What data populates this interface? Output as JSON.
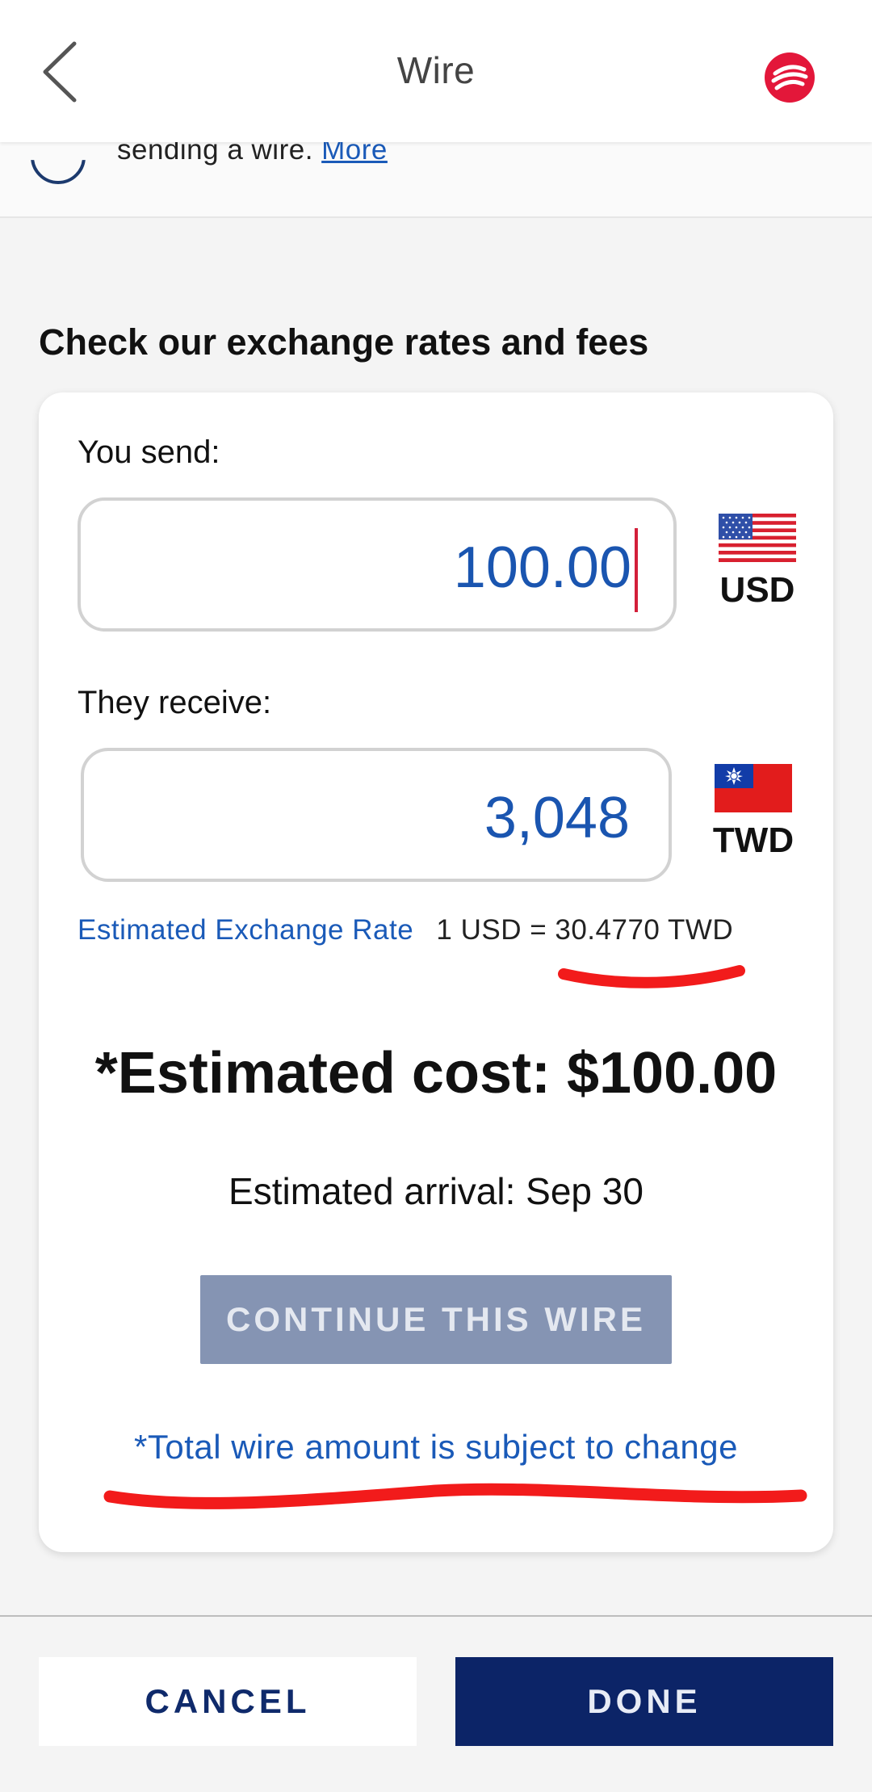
{
  "header": {
    "title": "Wire",
    "back_icon": "chevron-left-icon",
    "logo_icon": "bank-logo-icon",
    "brand_color": "#e3173a"
  },
  "info": {
    "text": "sending a wire.",
    "link_label": "More",
    "icon": "info-icon"
  },
  "section": {
    "title": "Check our exchange rates and fees"
  },
  "converter": {
    "send_label": "You send:",
    "send_value": "100.00",
    "send_currency": "USD",
    "send_flag": "us-flag-icon",
    "receive_label": "They receive:",
    "receive_value": "3,048",
    "receive_currency": "TWD",
    "receive_flag": "taiwan-flag-icon",
    "rate_label": "Estimated Exchange Rate",
    "rate_value": "1 USD = 30.4770 TWD"
  },
  "summary": {
    "estimated_cost": "*Estimated cost: $100.00",
    "arrival": "Estimated arrival: Sep 30",
    "continue_label": "CONTINUE THIS WIRE",
    "disclaimer": "*Total wire amount is subject to change"
  },
  "footer": {
    "cancel_label": "CANCEL",
    "done_label": "DONE"
  },
  "colors": {
    "accent_blue": "#1a5ab8",
    "primary_navy": "#0c2467",
    "disabled_button": "#8594b3",
    "annotation_red": "#f21b1b"
  }
}
